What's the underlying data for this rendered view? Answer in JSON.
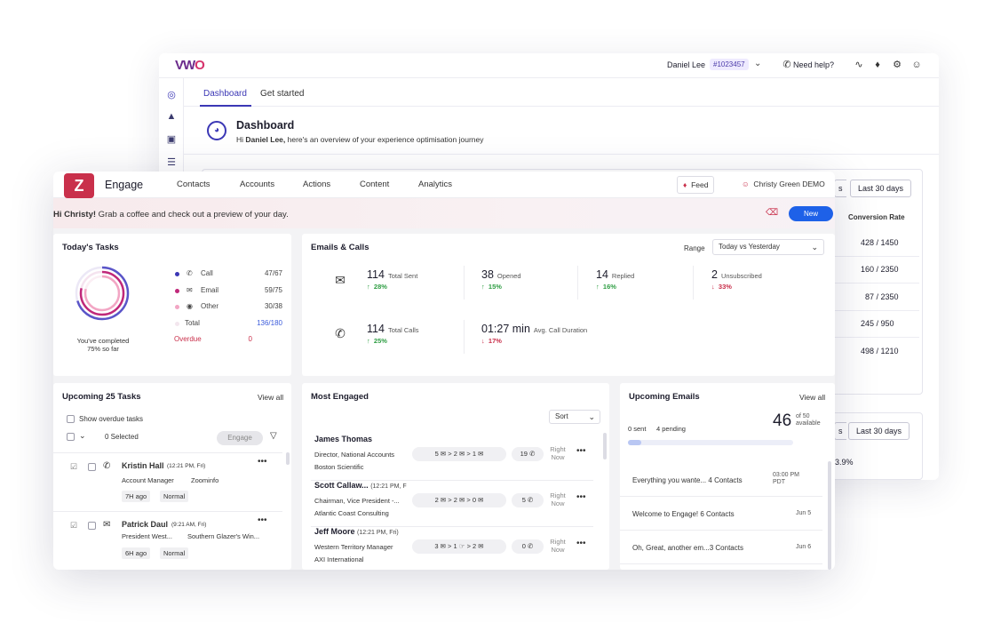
{
  "vwo": {
    "logo": "VWO",
    "user_name": "Daniel Lee",
    "account_id": "#1023457",
    "help_label": "Need help?",
    "tabs": [
      {
        "label": "Dashboard"
      },
      {
        "label": "Get started"
      }
    ],
    "page_title": "Dashboard",
    "greeting_prefix": "Hi ",
    "greeting_name": "Daniel Lee,",
    "greeting_suffix": " here's an overview of your experience optimisation journey",
    "panel1": {
      "range_partial": "s",
      "range_label": "Last 30 days",
      "column_header": "Conversion Rate",
      "conversion_values": [
        "428 / 1450",
        "160 / 2350",
        "87 / 2350",
        "245 / 950",
        "498 / 1210"
      ]
    },
    "panel2": {
      "range_partial": "s",
      "range_label": "Last 30 days",
      "percent_partial": "3.9%"
    }
  },
  "engage": {
    "logo_letter": "Z",
    "brand": "Engage",
    "nav": [
      "Contacts",
      "Accounts",
      "Actions",
      "Content",
      "Analytics"
    ],
    "feed_label": "Feed",
    "user": "Christy Green DEMO",
    "greeting_name": "Hi Christy!",
    "greeting_text": " Grab a coffee and check out a preview of your day.",
    "new_button": "New",
    "todays_tasks": {
      "title": "Today's Tasks",
      "caption_line1": "You've completed",
      "caption_line2": "75% so far",
      "completed_fraction": 0.75,
      "rows": [
        {
          "label": "Call",
          "value": "47/67",
          "dot": "#3b37b5"
        },
        {
          "label": "Email",
          "value": "59/75",
          "dot": "#c0287a"
        },
        {
          "label": "Other",
          "value": "30/38",
          "dot": "#f2a6c4"
        },
        {
          "label": "Total",
          "value": "136/180",
          "dot": "#f3e6ee"
        },
        {
          "label": "Overdue",
          "value": "0",
          "dot": ""
        }
      ]
    },
    "emails_calls": {
      "title": "Emails & Calls",
      "range_label": "Range",
      "range_value": "Today vs Yesterday",
      "metrics": [
        {
          "value": "114",
          "label": "Total Sent",
          "change": "28%",
          "direction": "up"
        },
        {
          "value": "38",
          "label": "Opened",
          "change": "15%",
          "direction": "up"
        },
        {
          "value": "14",
          "label": "Replied",
          "change": "16%",
          "direction": "up"
        },
        {
          "value": "2",
          "label": "Unsubscribed",
          "change": "33%",
          "direction": "down"
        },
        {
          "value": "114",
          "label": "Total Calls",
          "change": "25%",
          "direction": "up"
        },
        {
          "value": "01:27 min",
          "label": "Avg. Call Duration",
          "change": "17%",
          "direction": "down"
        }
      ]
    },
    "upcoming_tasks": {
      "title": "Upcoming 25 Tasks",
      "view_all": "View all",
      "show_overdue": "Show overdue tasks",
      "selected": "0 Selected",
      "engage_button": "Engage",
      "tasks": [
        {
          "name": "Kristin Hall",
          "time": "(12:21 PM, Fri)",
          "role": "Account Manager",
          "company": "Zoominfo",
          "ago": "7H ago",
          "priority": "Normal"
        },
        {
          "name": "Patrick Daul",
          "time": "(9:21 AM, Fri)",
          "role": "President West...",
          "company": "Southern Glazer's Win...",
          "ago": "6H ago",
          "priority": "Normal"
        }
      ]
    },
    "most_engaged": {
      "title": "Most Engaged",
      "sort_label": "Sort",
      "people": [
        {
          "name": "James Thomas",
          "time": "",
          "title": "Director, National Accounts",
          "company": "Boston Scientific",
          "seq": [
            "5",
            "2",
            "1"
          ],
          "calls": "19",
          "when1": "Right",
          "when2": "Now"
        },
        {
          "name": "Scott Callaw...",
          "time": "(12:21 PM, F",
          "title": "Chairman, Vice President -...",
          "company": "Atlantic Coast Consulting",
          "seq": [
            "2",
            "2",
            "0"
          ],
          "calls": "5",
          "when1": "Right",
          "when2": "Now"
        },
        {
          "name": "Jeff Moore",
          "time": "(12:21 PM, Fri)",
          "title": "Western Territory Manager",
          "company": "AXI International",
          "seq": [
            "3",
            "1",
            "2"
          ],
          "calls": "0",
          "when1": "Right",
          "when2": "Now"
        }
      ]
    },
    "upcoming_emails": {
      "title": "Upcoming Emails",
      "view_all": "View all",
      "sent": "0 sent",
      "pending": "4 pending",
      "count": "46",
      "of_line1": "of 50",
      "of_line2": "available",
      "progress_fraction": 0.08,
      "emails": [
        {
          "subject": "Everything you wante...",
          "contacts": "4 Contacts",
          "date1": "03:00 PM",
          "date2": "PDT"
        },
        {
          "subject": "Welcome to Engage!",
          "contacts": "6 Contacts",
          "date1": "Jun 5",
          "date2": ""
        },
        {
          "subject": "Oh, Great, another em...",
          "contacts": "3 Contacts",
          "date1": "Jun 6",
          "date2": ""
        }
      ]
    }
  }
}
